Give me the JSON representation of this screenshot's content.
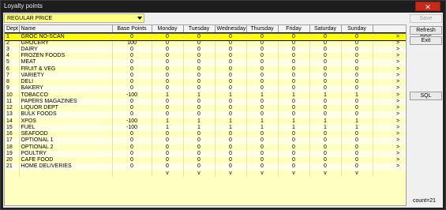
{
  "window": {
    "title": "Loyalty points",
    "close_label": "✕"
  },
  "dropdown": {
    "value": "REGULAR PRICE"
  },
  "table": {
    "headers": [
      "Dept",
      "Name",
      "Base Points",
      "Monday",
      "Tuesday",
      "Wednesday",
      "Thursday",
      "Friday",
      "Saturday",
      "Sunday",
      ""
    ],
    "rows": [
      [
        "1",
        "GROC NO-SCAN",
        "0",
        "0",
        "0",
        "0",
        "0",
        "0",
        "0",
        "0",
        ">"
      ],
      [
        "2",
        "GROCERY",
        "100",
        "0",
        "0",
        "0",
        "0",
        "0",
        "0",
        "0",
        ">"
      ],
      [
        "3",
        "DAIRY",
        "0",
        "0",
        "0",
        "0",
        "0",
        "0",
        "0",
        "0",
        ">"
      ],
      [
        "4",
        "FROZEN FOODS",
        "0",
        "0",
        "0",
        "0",
        "0",
        "0",
        "0",
        "0",
        ">"
      ],
      [
        "5",
        "MEAT",
        "0",
        "0",
        "0",
        "0",
        "0",
        "0",
        "0",
        "0",
        ">"
      ],
      [
        "6",
        "FRUIT & VEG",
        "0",
        "0",
        "0",
        "0",
        "0",
        "0",
        "0",
        "0",
        ">"
      ],
      [
        "7",
        "VARIETY",
        "0",
        "0",
        "0",
        "0",
        "0",
        "0",
        "0",
        "0",
        ">"
      ],
      [
        "8",
        "DELI",
        "0",
        "0",
        "0",
        "0",
        "0",
        "0",
        "0",
        "0",
        ">"
      ],
      [
        "9",
        "BAKERY",
        "0",
        "0",
        "0",
        "0",
        "0",
        "0",
        "0",
        "0",
        ">"
      ],
      [
        "10",
        "TOBACCO",
        "-100",
        "1",
        "1",
        "1",
        "1",
        "1",
        "1",
        "1",
        ">"
      ],
      [
        "11",
        "PAPERS MAGAZINES",
        "0",
        "0",
        "0",
        "0",
        "0",
        "0",
        "0",
        "0",
        ">"
      ],
      [
        "12",
        "LIQUOR DEPT",
        "0",
        "0",
        "0",
        "0",
        "0",
        "0",
        "0",
        "0",
        ">"
      ],
      [
        "13",
        "BULK FOODS",
        "0",
        "0",
        "0",
        "0",
        "0",
        "0",
        "0",
        "0",
        ">"
      ],
      [
        "14",
        "XPOS",
        "-100",
        "1",
        "1",
        "1",
        "1",
        "1",
        "1",
        "1",
        ">"
      ],
      [
        "15",
        "FUEL",
        "-100",
        "1",
        "1",
        "1",
        "1",
        "1",
        "1",
        "1",
        ">"
      ],
      [
        "16",
        "SEAFOOD",
        "0",
        "0",
        "0",
        "0",
        "0",
        "0",
        "0",
        "0",
        ">"
      ],
      [
        "17",
        "OPTIONAL 1",
        "0",
        "0",
        "0",
        "0",
        "0",
        "0",
        "0",
        "0",
        ">"
      ],
      [
        "18",
        "OPTIONAL 2",
        "0",
        "0",
        "0",
        "0",
        "0",
        "0",
        "0",
        "0",
        ">"
      ],
      [
        "19",
        "POULTRY",
        "0",
        "0",
        "0",
        "0",
        "0",
        "0",
        "0",
        "0",
        ">"
      ],
      [
        "20",
        "CAFE FOOD",
        "0",
        "0",
        "0",
        "0",
        "0",
        "0",
        "0",
        "0",
        ">"
      ],
      [
        "21",
        "HOME DELIVERIES",
        "0",
        "0",
        "0",
        "0",
        "0",
        "0",
        "0",
        "0",
        ">"
      ]
    ],
    "footer": [
      "",
      "",
      "",
      "v",
      "v",
      "v",
      "v",
      "v",
      "v",
      "v",
      ""
    ],
    "selected_row": 0
  },
  "buttons": {
    "save": "Save",
    "refresh_pos": "Refresh POS",
    "exit": "Exit",
    "sql": "SQL"
  },
  "status": {
    "count": "count=21"
  },
  "colors": {
    "grid_bg": "#ffffc0",
    "row_alt": "#ffffe8",
    "selected": "#ffff00",
    "close": "#c42b1c"
  }
}
